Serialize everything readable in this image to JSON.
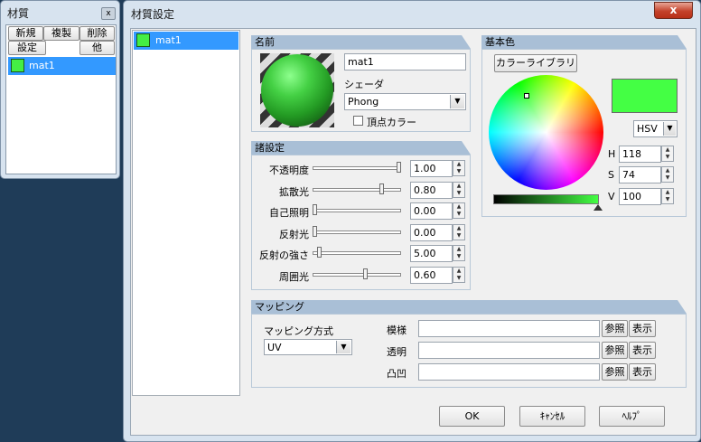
{
  "small_panel": {
    "title": "材質",
    "close_label": "x",
    "buttons": [
      "新規",
      "複製",
      "削除",
      "設定",
      "他"
    ],
    "list_item": "mat1",
    "swatch_color": "#44ee44"
  },
  "dialog": {
    "title": "材質設定",
    "close_label": "x",
    "list_item": "mat1",
    "swatch_color": "#44ee44",
    "name_section": {
      "header": "名前",
      "name_value": "mat1",
      "shader_label": "シェーダ",
      "shader_value": "Phong",
      "vertex_color_label": "頂点カラー"
    },
    "params_section": {
      "header": "諸設定",
      "rows": [
        {
          "label": "不透明度",
          "value": "1.00",
          "level": 1.0
        },
        {
          "label": "拡散光",
          "value": "0.80",
          "level": 0.8
        },
        {
          "label": "自己照明",
          "value": "0.00",
          "level": 0.0
        },
        {
          "label": "反射光",
          "value": "0.00",
          "level": 0.0
        },
        {
          "label": "反射の強さ",
          "value": "5.00",
          "level": 0.05
        },
        {
          "label": "周囲光",
          "value": "0.60",
          "level": 0.6
        }
      ]
    },
    "color_section": {
      "header": "基本色",
      "library_button": "カラーライブラリ",
      "mode": "HSV",
      "h_label": "H",
      "h_value": "118",
      "s_label": "S",
      "s_value": "74",
      "v_label": "V",
      "v_value": "100",
      "current_color": "#44ff44"
    },
    "mapping_section": {
      "header": "マッピング",
      "method_label": "マッピング方式",
      "method_value": "UV",
      "rows": [
        {
          "label": "模様",
          "value": "",
          "ref": "参照",
          "show": "表示"
        },
        {
          "label": "透明",
          "value": "",
          "ref": "参照",
          "show": "表示"
        },
        {
          "label": "凸凹",
          "value": "",
          "ref": "参照",
          "show": "表示"
        }
      ]
    },
    "footer": {
      "ok": "OK",
      "cancel": "ｷｬﾝｾﾙ",
      "help": "ﾍﾙﾌﾟ"
    }
  }
}
